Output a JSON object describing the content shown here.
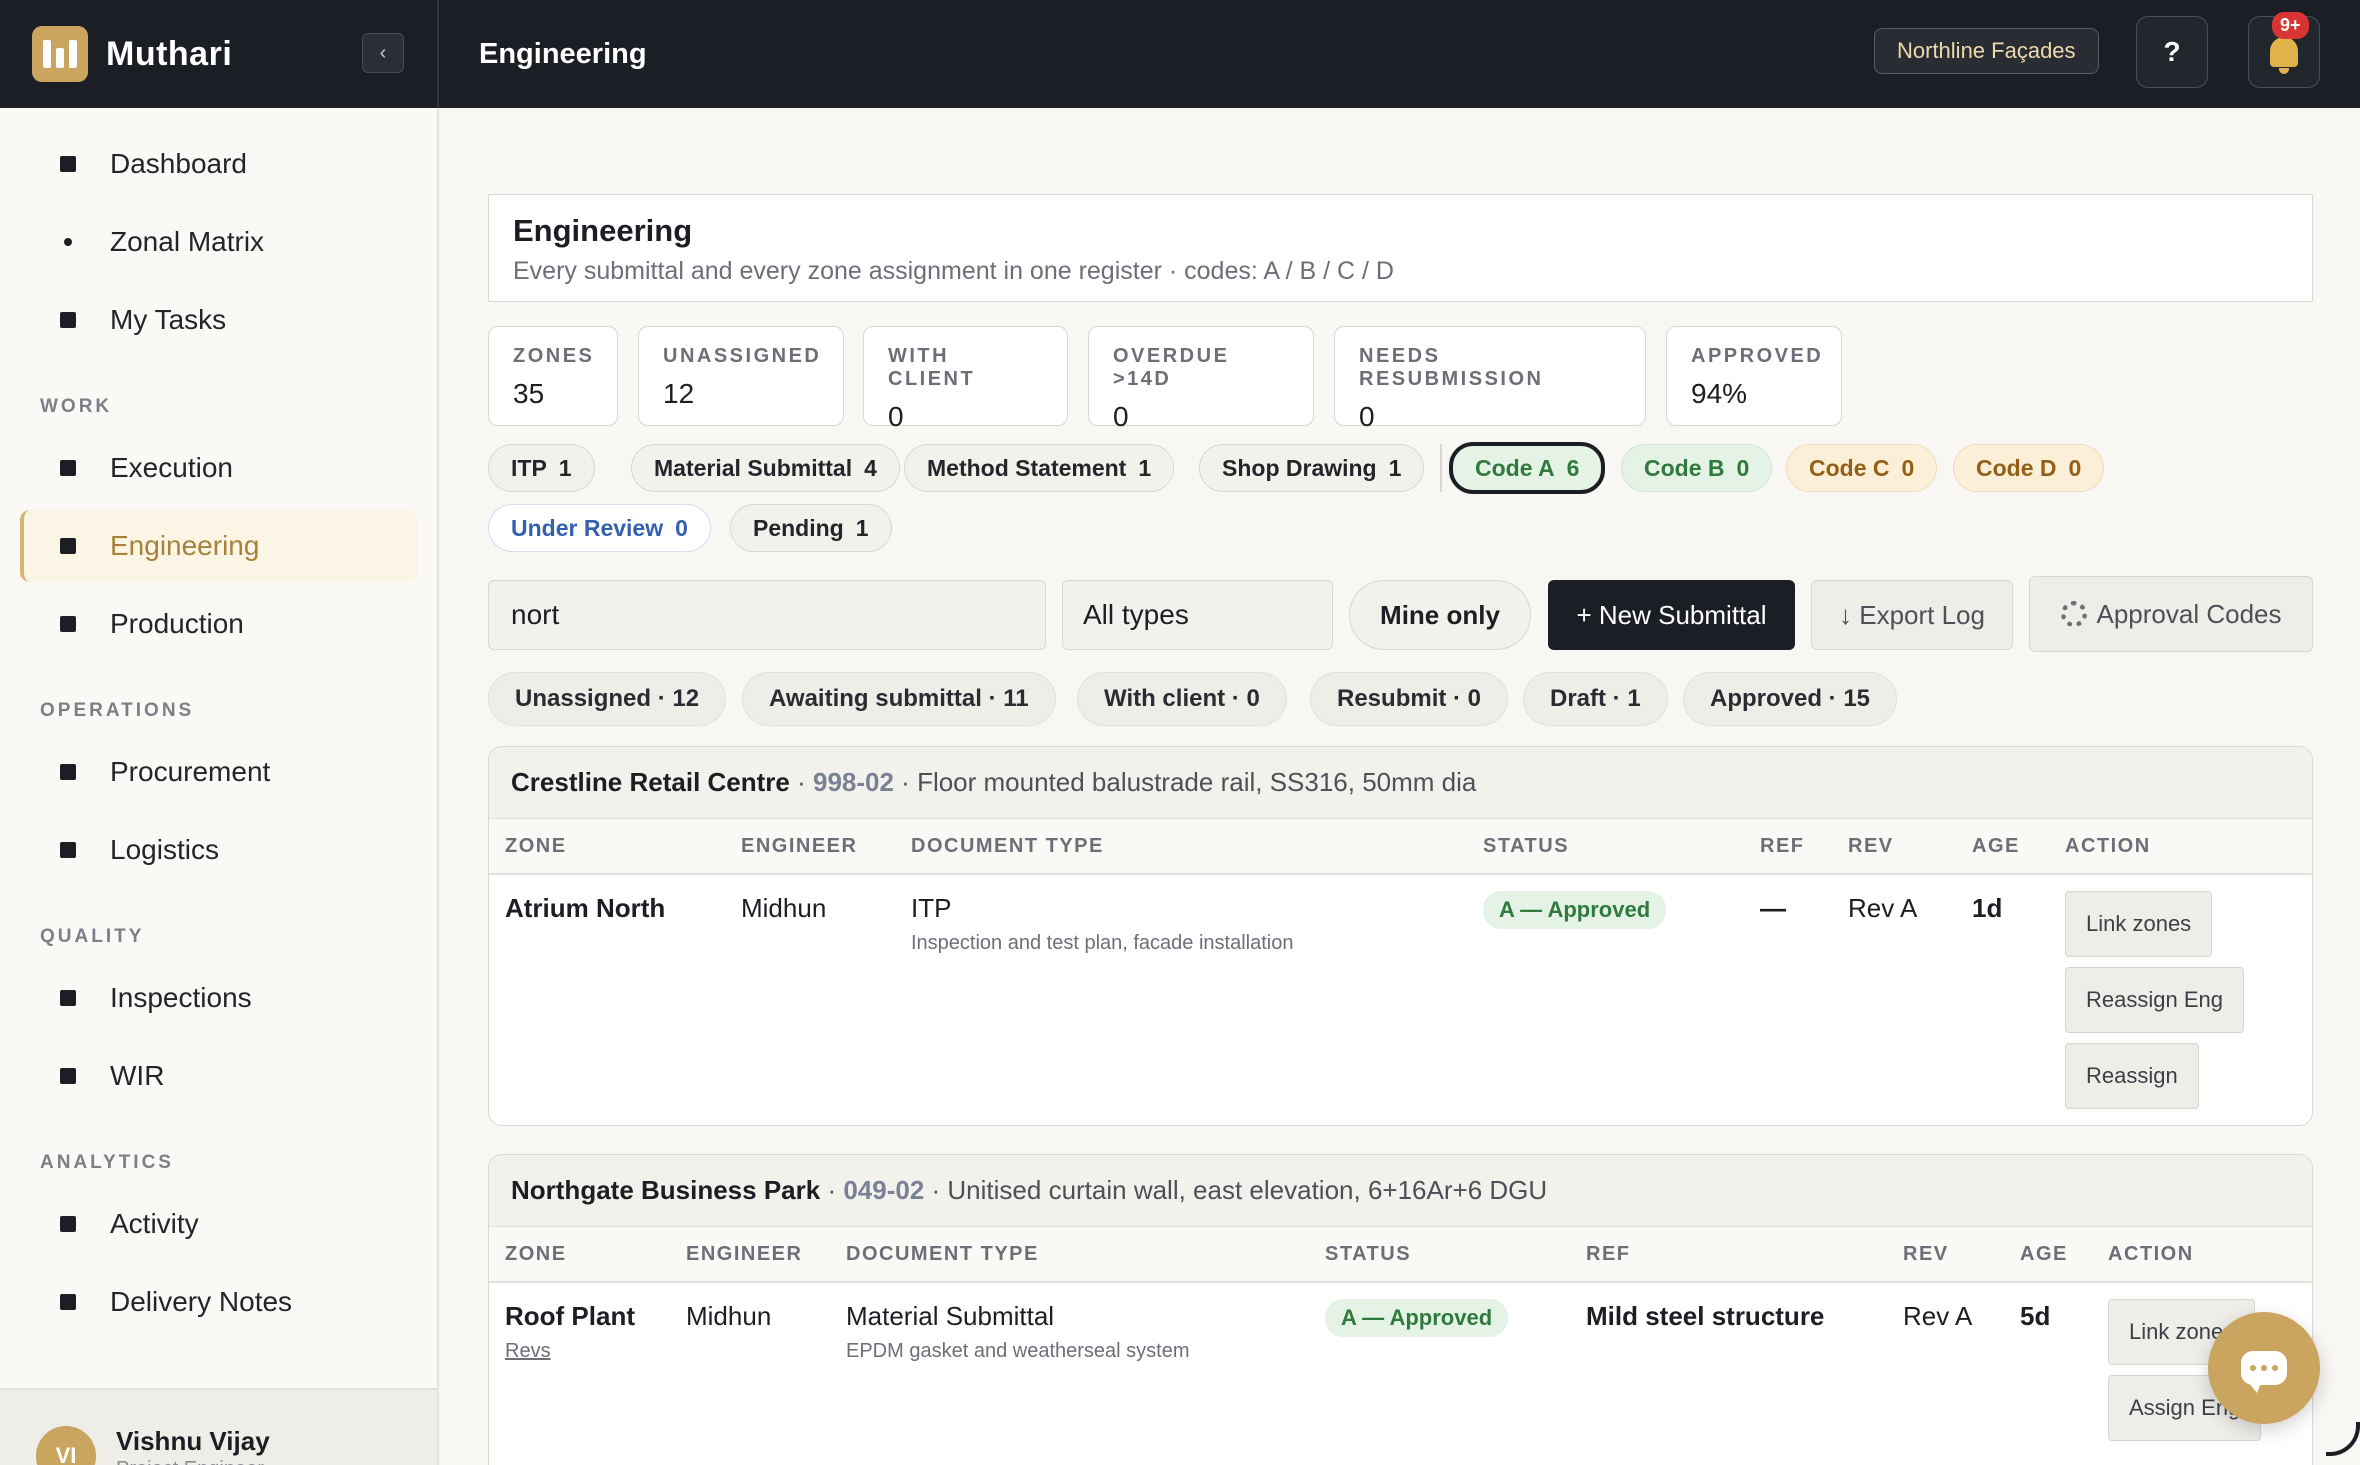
{
  "app": {
    "name": "Muthari",
    "page_title": "Engineering",
    "tenant": "Northline Façades",
    "help_label": "?",
    "notifications": "9+"
  },
  "sidebar": {
    "items": [
      {
        "label": "Dashboard"
      },
      {
        "label": "Zonal Matrix"
      },
      {
        "label": "My Tasks"
      },
      {
        "label": "Execution"
      },
      {
        "label": "Engineering"
      },
      {
        "label": "Production"
      },
      {
        "label": "Procurement"
      },
      {
        "label": "Logistics"
      },
      {
        "label": "Inspections"
      },
      {
        "label": "WIR"
      },
      {
        "label": "Activity"
      },
      {
        "label": "Delivery Notes"
      }
    ],
    "sections": {
      "work": "WORK",
      "operations": "OPERATIONS",
      "quality": "QUALITY",
      "analytics": "ANALYTICS"
    },
    "user": {
      "initials": "VI",
      "name": "Vishnu Vijay",
      "role": "Project Engineer"
    }
  },
  "header": {
    "title": "Engineering",
    "subtitle": "Every submittal and every zone assignment in one register · codes: A / B / C / D"
  },
  "stats": [
    {
      "label": "ZONES",
      "value": "35"
    },
    {
      "label": "UNASSIGNED",
      "value": "12"
    },
    {
      "label": "WITH CLIENT",
      "value": "0"
    },
    {
      "label": "OVERDUE >14D",
      "value": "0"
    },
    {
      "label": "NEEDS RESUBMISSION",
      "value": "0"
    },
    {
      "label": "APPROVED",
      "value": "94%"
    }
  ],
  "type_chips": [
    {
      "label": "ITP",
      "count": "1"
    },
    {
      "label": "Material Submittal",
      "count": "4"
    },
    {
      "label": "Method Statement",
      "count": "1"
    },
    {
      "label": "Shop Drawing",
      "count": "1"
    }
  ],
  "code_chips": [
    {
      "label": "Code A",
      "count": "6"
    },
    {
      "label": "Code B",
      "count": "0"
    },
    {
      "label": "Code C",
      "count": "0"
    },
    {
      "label": "Code D",
      "count": "0"
    },
    {
      "label": "Under Review",
      "count": "0"
    },
    {
      "label": "Pending",
      "count": "1"
    }
  ],
  "toolbar": {
    "search_value": "nort",
    "type_filter": "All types",
    "mine_only": "Mine only",
    "new_submittal": "+ New Submittal",
    "export": "↓ Export Log",
    "approval_codes": "Approval Codes"
  },
  "filter_chips": [
    {
      "label": "Unassigned · 12"
    },
    {
      "label": "Awaiting submittal · 11"
    },
    {
      "label": "With client · 0"
    },
    {
      "label": "Resubmit · 0"
    },
    {
      "label": "Draft · 1"
    },
    {
      "label": "Approved · 15"
    }
  ],
  "table_headers": {
    "zone": "ZONE",
    "engineer": "ENGINEER",
    "doc_type": "DOCUMENT TYPE",
    "status": "STATUS",
    "ref": "REF",
    "rev": "REV",
    "age": "AGE",
    "action": "ACTION"
  },
  "groups": [
    {
      "project": "Crestline Retail Centre",
      "code": "998-02",
      "desc": "Floor mounted balustrade rail, SS316, 50mm dia",
      "rows": [
        {
          "zone": "Atrium North",
          "engineer": "Midhun",
          "doc_type": "ITP",
          "doc_desc": "Inspection and test plan, facade installation",
          "status": "A — Approved",
          "ref": "—",
          "rev": "Rev A",
          "age": "1d",
          "actions": [
            "Link zones",
            "Reassign Eng",
            "Reassign"
          ]
        }
      ]
    },
    {
      "project": "Northgate Business Park",
      "code": "049-02",
      "desc": "Unitised curtain wall, east elevation, 6+16Ar+6 DGU",
      "rows": [
        {
          "zone": "Roof Plant",
          "zone_link": "Revs",
          "engineer": "Midhun",
          "doc_type": "Material Submittal",
          "doc_desc": "EPDM gasket and weatherseal system",
          "status": "A — Approved",
          "ref": "Mild steel structure",
          "rev": "Rev A",
          "age": "5d",
          "actions": [
            "Link zones",
            "Assign Eng"
          ]
        }
      ]
    }
  ]
}
